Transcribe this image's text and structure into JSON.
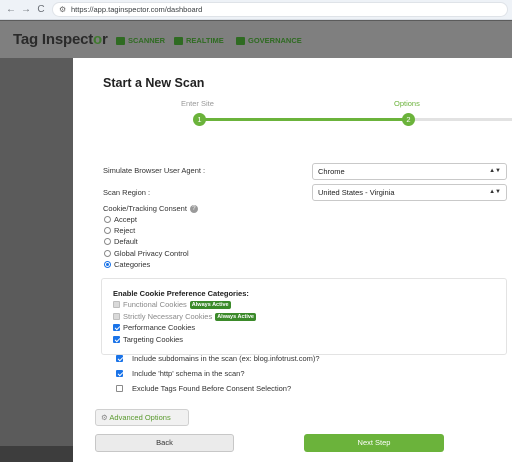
{
  "browser": {
    "url": "https://app.taginspector.com/dashboard",
    "back_icon": "←",
    "forward_icon": "→",
    "reload_icon": "C",
    "site_info_icon": "⚙"
  },
  "header": {
    "logo_text_main": "Tag Inspect",
    "logo_text_o": "o",
    "logo_text_end": "r",
    "nav": [
      {
        "label": "SCANNER",
        "icon": "camera-icon"
      },
      {
        "label": "REALTIME",
        "icon": "heartbeat-icon"
      },
      {
        "label": "GOVERNANCE",
        "icon": "bank-icon"
      }
    ]
  },
  "modal": {
    "title": "Start a New Scan",
    "steps": [
      {
        "label": "Enter Site",
        "number": "1",
        "color": "#999999"
      },
      {
        "label": "Options",
        "number": "2",
        "color": "#6bb33b"
      }
    ],
    "user_agent_label": "Simulate Browser User Agent :",
    "user_agent_value": "Chrome",
    "region_label": "Scan Region :",
    "region_value": "United States - Virginia",
    "consent_label": "Cookie/Tracking Consent",
    "help_icon": "?",
    "consent_options": [
      {
        "label": "Accept",
        "selected": false
      },
      {
        "label": "Reject",
        "selected": false
      },
      {
        "label": "Default",
        "selected": false
      },
      {
        "label": "Global Privacy Control",
        "selected": false
      },
      {
        "label": "Categories",
        "selected": true
      }
    ],
    "cookie_box": {
      "title": "Enable Cookie Preference Categories:",
      "categories": [
        {
          "label": "Functional Cookies",
          "badge": "Always Active",
          "checked": true,
          "disabled": true
        },
        {
          "label": "Strictly Necessary Cookies",
          "badge": "Always Active",
          "checked": true,
          "disabled": true
        },
        {
          "label": "Performance Cookies",
          "badge": "",
          "checked": true,
          "disabled": false
        },
        {
          "label": "Targeting Cookies",
          "badge": "",
          "checked": true,
          "disabled": false
        }
      ]
    },
    "options": [
      {
        "label": "Include subdomains in the scan (ex: blog.infotrust.com)?",
        "checked": true
      },
      {
        "label": "Include 'http' schema in the scan?",
        "checked": true
      },
      {
        "label": "Exclude Tags Found Before Consent Selection?",
        "checked": false
      }
    ],
    "advanced_options_label": "Advanced Options",
    "gear_icon": "⚙",
    "back_label": "Back",
    "next_label": "Next Step"
  }
}
